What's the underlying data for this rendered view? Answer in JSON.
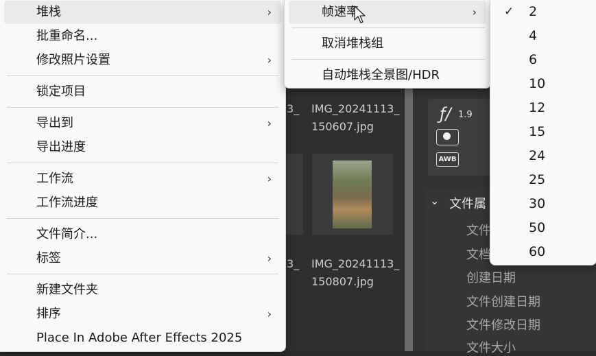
{
  "background": {
    "thumb_names": [
      {
        "frag": "3_",
        "name_line1": "IMG_20241113_",
        "name_line2": "150607.jpg"
      },
      {
        "frag": "3_",
        "name_line1": "IMG_20241113_",
        "name_line2": "150807.jpg"
      }
    ],
    "meta": {
      "aperture_symbol": "ƒ/",
      "aperture_value": "1.9",
      "awb": "AWB"
    },
    "props": {
      "title": "文件属",
      "items": [
        "文件",
        "文档",
        "创建日期",
        "文件创建日期",
        "文件修改日期",
        "文件大小"
      ]
    }
  },
  "context_menu": {
    "items": [
      {
        "label": "堆栈",
        "has_submenu": true
      },
      {
        "label": "批重命名...",
        "has_submenu": false
      },
      {
        "label": "修改照片设置",
        "has_submenu": true
      },
      {
        "label": "锁定项目",
        "has_submenu": false
      },
      {
        "label": "导出到",
        "has_submenu": true
      },
      {
        "label": "导出进度",
        "has_submenu": false
      },
      {
        "label": "工作流",
        "has_submenu": true
      },
      {
        "label": "工作流进度",
        "has_submenu": false
      },
      {
        "label": "文件简介...",
        "has_submenu": false
      },
      {
        "label": "标签",
        "has_submenu": true
      },
      {
        "label": "新建文件夹",
        "has_submenu": false
      },
      {
        "label": "排序",
        "has_submenu": true
      },
      {
        "label": "Place In Adobe After Effects 2025",
        "has_submenu": false
      }
    ]
  },
  "stack_submenu": {
    "items": [
      {
        "label": "帧速率",
        "has_submenu": true
      },
      {
        "label": "取消堆栈组",
        "has_submenu": false
      },
      {
        "label": "自动堆栈全景图/HDR",
        "has_submenu": false
      }
    ]
  },
  "framerate_submenu": {
    "selected": "2",
    "options": [
      "2",
      "4",
      "6",
      "10",
      "12",
      "15",
      "24",
      "25",
      "30",
      "50",
      "60"
    ]
  },
  "icons": {
    "chevron": "›",
    "check": "✓"
  }
}
